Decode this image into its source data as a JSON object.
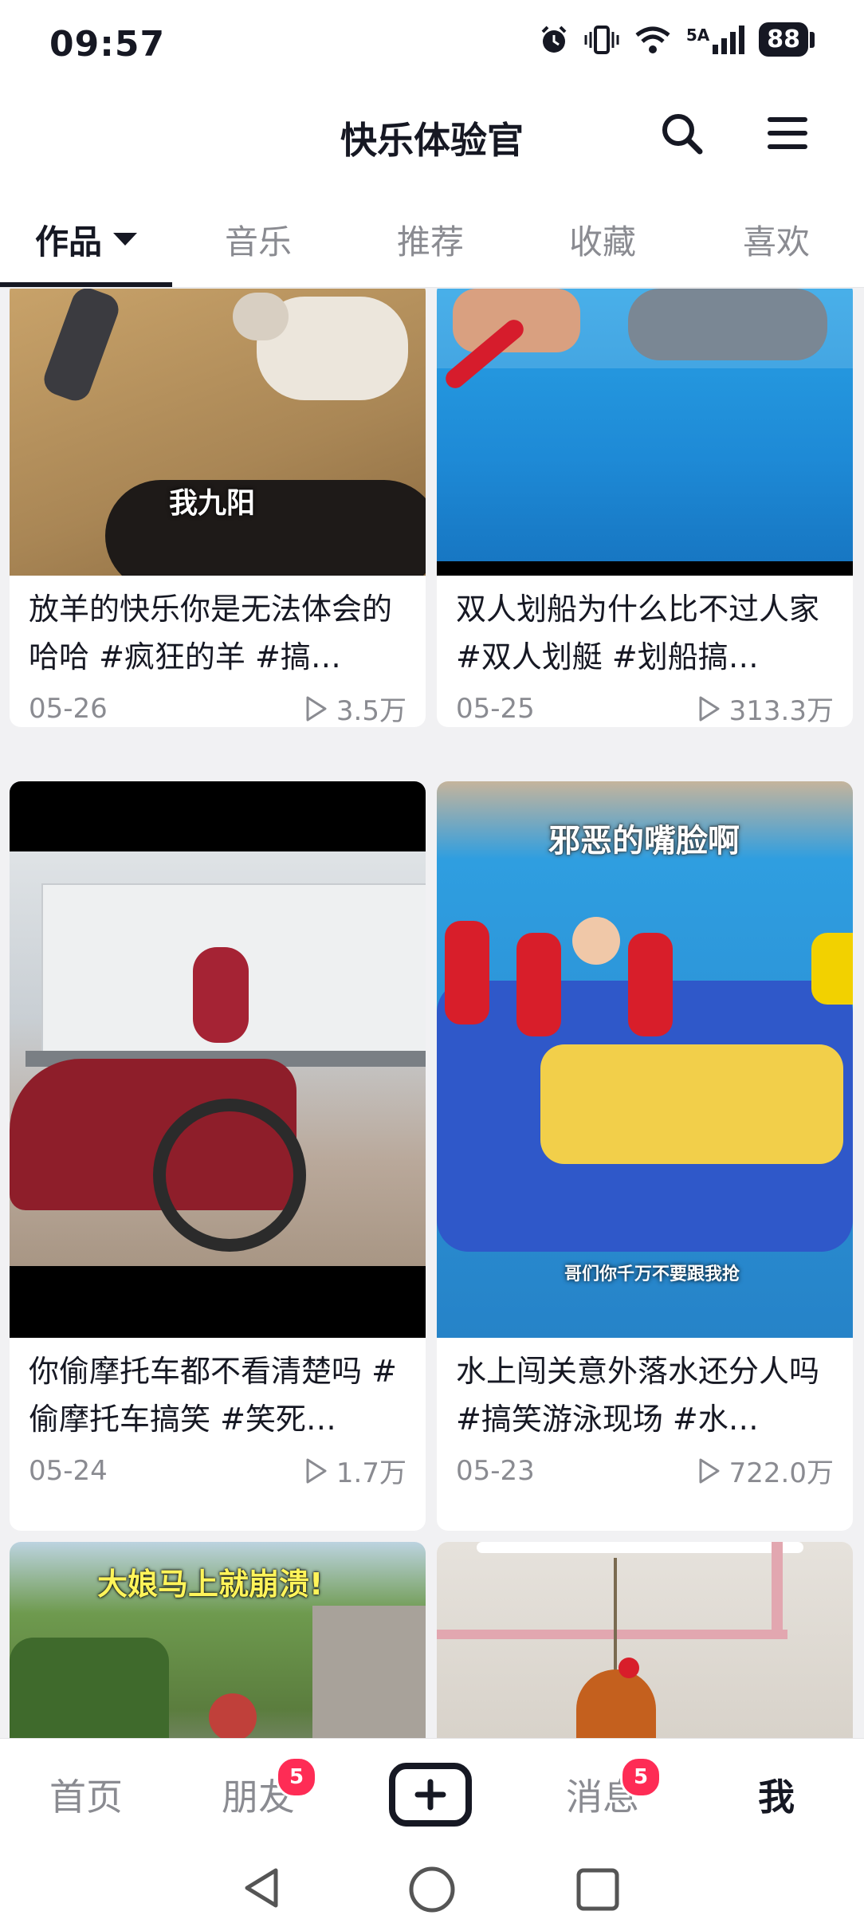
{
  "status_bar": {
    "time": "09:57",
    "network": "5A",
    "battery": "88"
  },
  "header": {
    "title": "快乐体验官"
  },
  "tabs": [
    {
      "label": "作品",
      "active": true
    },
    {
      "label": "音乐",
      "active": false
    },
    {
      "label": "推荐",
      "active": false
    },
    {
      "label": "收藏",
      "active": false
    },
    {
      "label": "喜欢",
      "active": false
    }
  ],
  "videos": [
    {
      "overlay": "我九阳",
      "caption": "放羊的快乐你是无法体会的哈哈 #疯狂的羊 #搞…",
      "date": "05-26",
      "plays": "3.5万"
    },
    {
      "overlay": "",
      "caption": "双人划船为什么比不过人家 #双人划艇 #划船搞…",
      "date": "05-25",
      "plays": "313.3万"
    },
    {
      "overlay": "",
      "caption": "你偷摩托车都不看清楚吗 #偷摩托车搞笑 #笑死…",
      "date": "05-24",
      "plays": "1.7万"
    },
    {
      "overlay": "邪恶的嘴脸啊",
      "overlay_sub": "哥们你千万不要跟我抢",
      "caption": "水上闯关意外落水还分人吗 #搞笑游泳现场 #水…",
      "date": "05-23",
      "plays": "722.0万"
    },
    {
      "overlay": "大娘马上就崩溃!"
    },
    {
      "overlay": ""
    }
  ],
  "bottom_nav": {
    "home": "首页",
    "friends": "朋友",
    "friends_badge": "5",
    "messages": "消息",
    "messages_badge": "5",
    "me": "我"
  },
  "colors": {
    "accent": "#fe2c55",
    "text": "#161823",
    "muted": "#8a8b91"
  }
}
